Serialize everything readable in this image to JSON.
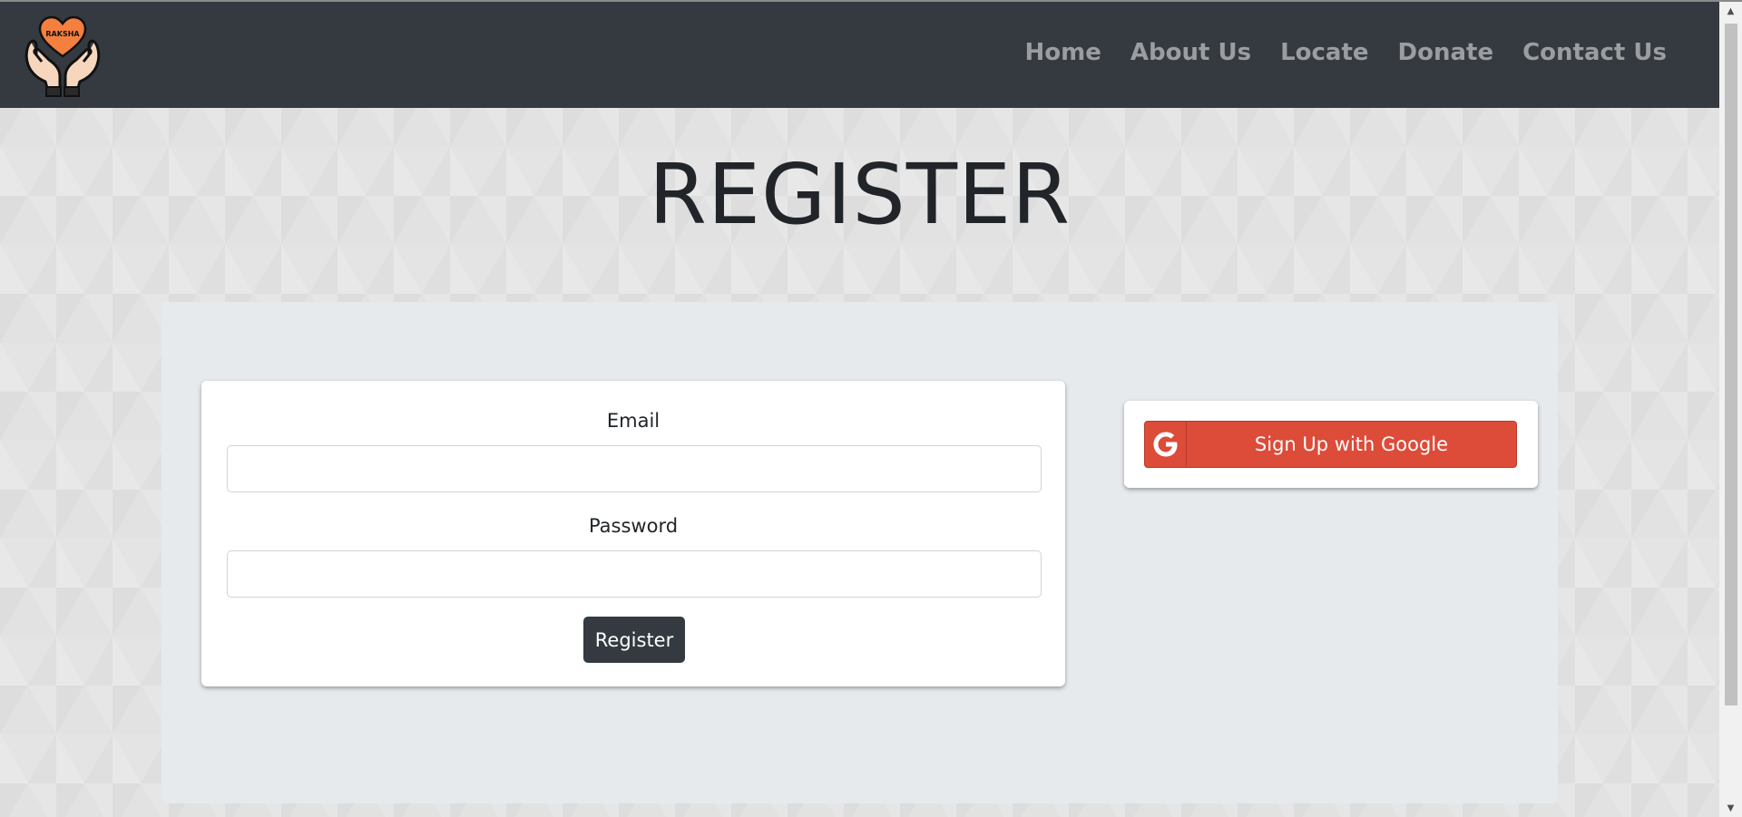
{
  "navbar": {
    "logo_text": "RAKSHA",
    "links": [
      {
        "label": "Home"
      },
      {
        "label": "About Us"
      },
      {
        "label": "Locate"
      },
      {
        "label": "Donate"
      },
      {
        "label": "Contact Us"
      }
    ]
  },
  "main": {
    "title": "REGISTER",
    "form": {
      "email_label": "Email",
      "email_value": "",
      "password_label": "Password",
      "password_value": "",
      "submit_label": "Register"
    },
    "google": {
      "label": "Sign Up with Google",
      "icon": "google-g-icon"
    }
  },
  "colors": {
    "navbar_bg": "#343a40",
    "nav_link": "#9b9da0",
    "panel_bg": "#e7eaed",
    "register_button": "#343a40",
    "google_button": "#dd4b39",
    "logo_heart": "#f47f3e"
  }
}
